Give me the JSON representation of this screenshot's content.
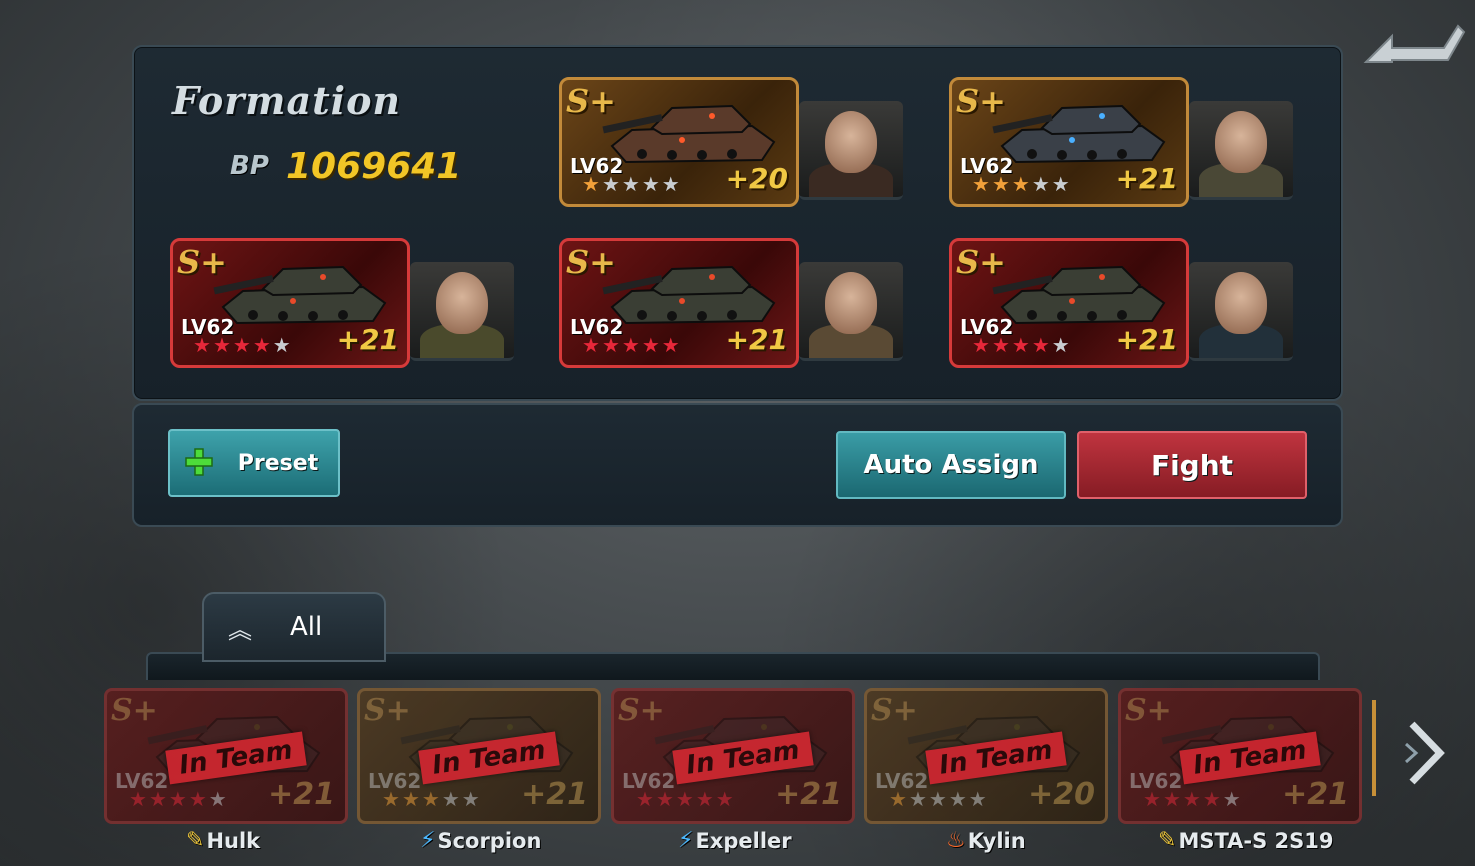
{
  "header": {
    "title": "Formation",
    "bp_label": "BP",
    "bp_value": "1069641"
  },
  "colors": {
    "accent_gold": "#f2c626",
    "teal_button": "#2a8690",
    "red_button": "#a82732"
  },
  "formation": [
    {
      "grade": "S+",
      "level": "LV62",
      "plus": "+20",
      "frame": "gold",
      "stars_total": 5,
      "stars_filled": 1,
      "commander_icon": "woman-commander-portrait"
    },
    {
      "grade": "S+",
      "level": "LV62",
      "plus": "+21",
      "frame": "gold",
      "stars_total": 5,
      "stars_filled": 3,
      "commander_icon": "officer-commander-portrait"
    },
    {
      "grade": "S+",
      "level": "LV62",
      "plus": "+21",
      "frame": "red",
      "stars_total": 5,
      "stars_filled": 4,
      "commander_icon": "general-cap-commander-portrait"
    },
    {
      "grade": "S+",
      "level": "LV62",
      "plus": "+21",
      "frame": "red",
      "stars_total": 5,
      "stars_filled": 5,
      "commander_icon": "helmet-commander-portrait"
    },
    {
      "grade": "S+",
      "level": "LV62",
      "plus": "+21",
      "frame": "red",
      "stars_total": 5,
      "stars_filled": 4,
      "commander_icon": "suit-commander-portrait"
    }
  ],
  "actions": {
    "preset": "Preset",
    "auto_assign": "Auto Assign",
    "fight": "Fight"
  },
  "filter_tab": {
    "label": "All"
  },
  "tank_list": [
    {
      "name": "Hulk",
      "grade": "S+",
      "level": "LV62",
      "plus": "+21",
      "frame": "red",
      "badge": "In Team",
      "stars_filled": 4,
      "type_icon": "artillery-icon"
    },
    {
      "name": "Scorpion",
      "grade": "S+",
      "level": "LV62",
      "plus": "+21",
      "frame": "gold",
      "badge": "In Team",
      "stars_filled": 3,
      "type_icon": "energy-icon"
    },
    {
      "name": "Expeller",
      "grade": "S+",
      "level": "LV62",
      "plus": "+21",
      "frame": "red",
      "badge": "In Team",
      "stars_filled": 5,
      "type_icon": "energy-icon"
    },
    {
      "name": "Kylin",
      "grade": "S+",
      "level": "LV62",
      "plus": "+20",
      "frame": "gold",
      "badge": "In Team",
      "stars_filled": 1,
      "type_icon": "fire-icon"
    },
    {
      "name": "MSTA-S 2S19",
      "grade": "S+",
      "level": "LV62",
      "plus": "+21",
      "frame": "red",
      "badge": "In Team",
      "stars_filled": 4,
      "type_icon": "artillery-icon"
    }
  ]
}
